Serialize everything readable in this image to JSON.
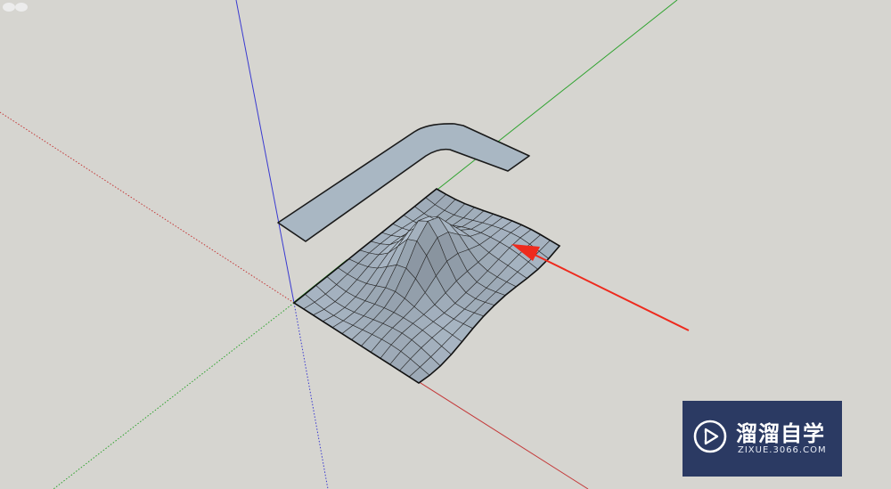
{
  "viewport": {
    "background": "#d6d5d0",
    "axis_colors": {
      "red": "#c43a3a",
      "green": "#2fa32f",
      "blue": "#3a3ad0"
    },
    "model_fill": "#a9b7c3",
    "arrow_color": "#ee2a1d"
  },
  "watermark": {
    "title": "溜溜自学",
    "subtitle": "ZIXUE.3066.COM",
    "icon": "play-icon",
    "background": "#2b3a63"
  }
}
